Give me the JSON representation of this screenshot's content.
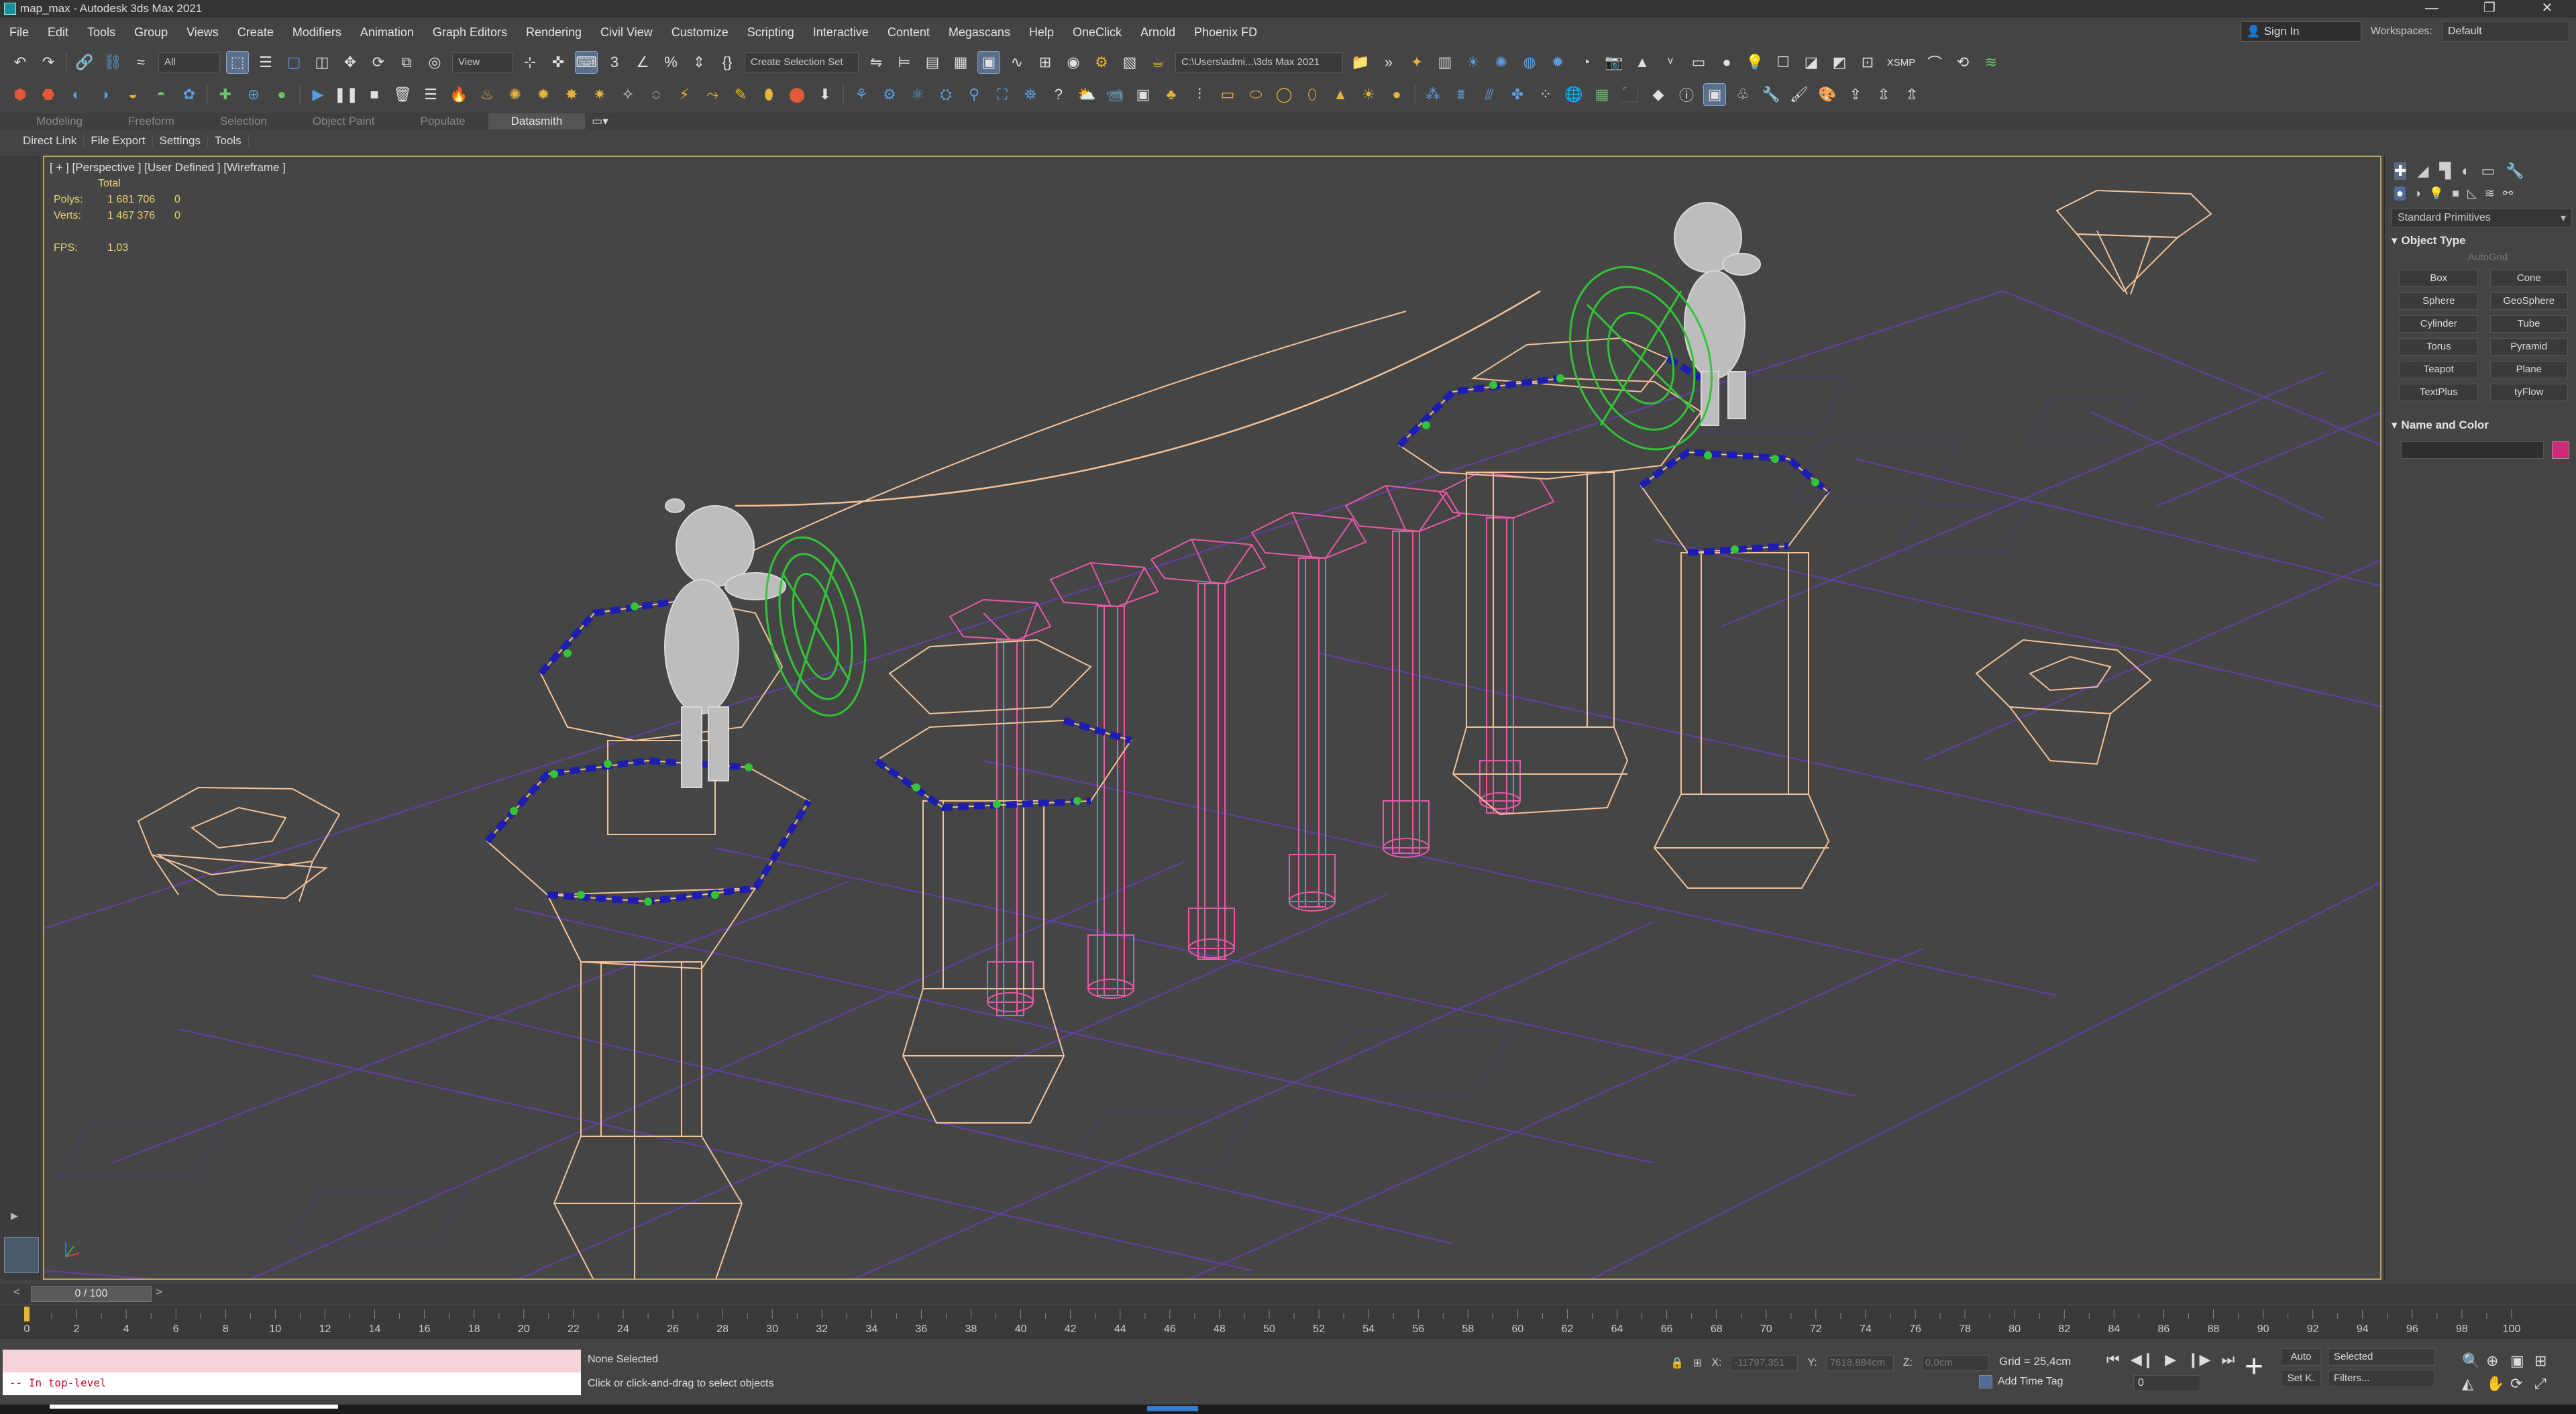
{
  "window": {
    "title": "map_max - Autodesk 3ds Max 2021",
    "controls": [
      "—",
      "❐",
      "✕"
    ]
  },
  "menubar": {
    "items": [
      "File",
      "Edit",
      "Tools",
      "Group",
      "Views",
      "Create",
      "Modifiers",
      "Animation",
      "Graph Editors",
      "Rendering",
      "Civil View",
      "Customize",
      "Scripting",
      "Interactive",
      "Content",
      "Megascans",
      "Help",
      "OneClick",
      "Arnold",
      "Phoenix FD"
    ],
    "signin": "Sign In",
    "workspaces_label": "Workspaces:",
    "workspace_value": "Default"
  },
  "toolbar1": {
    "filter": "All",
    "ref_coord": "View",
    "selection_set": "Create Selection Set",
    "path": "C:\\Users\\admi...\\3ds Max 2021",
    "xsmp": "XSMP"
  },
  "ribbon": {
    "tabs": [
      "Modeling",
      "Freeform",
      "Selection",
      "Object Paint",
      "Populate",
      "Datasmith"
    ],
    "active_tab": "Datasmith"
  },
  "subtabs": [
    "Direct Link",
    "File Export",
    "Settings",
    "Tools"
  ],
  "viewport": {
    "label": "[ + ] [Perspective ] [User Defined ] [Wireframe ]",
    "stats": {
      "header": "Total",
      "polys_label": "Polys:",
      "polys_value": "1 681 706",
      "polys_sel": "0",
      "verts_label": "Verts:",
      "verts_value": "1 467 376",
      "verts_sel": "0",
      "fps_label": "FPS:",
      "fps_value": "1,03"
    }
  },
  "command_panel": {
    "category": "Standard Primitives",
    "object_type_title": "Object Type",
    "autogrid": "AutoGrid",
    "primitives": [
      "Box",
      "Cone",
      "Sphere",
      "GeoSphere",
      "Cylinder",
      "Tube",
      "Torus",
      "Pyramid",
      "Teapot",
      "Plane",
      "TextPlus",
      "tyFlow"
    ],
    "name_color_title": "Name and Color",
    "swatch_color": "#d2287a"
  },
  "timeline": {
    "frame_display": "0 / 100",
    "ticks": [
      "0",
      "2",
      "4",
      "6",
      "8",
      "10",
      "12",
      "14",
      "16",
      "18",
      "20",
      "22",
      "24",
      "26",
      "28",
      "30",
      "32",
      "34",
      "36",
      "38",
      "40",
      "42",
      "44",
      "46",
      "48",
      "50",
      "52",
      "54",
      "56",
      "58",
      "60",
      "62",
      "64",
      "66",
      "68",
      "70",
      "72",
      "74",
      "76",
      "78",
      "80",
      "82",
      "84",
      "86",
      "88",
      "90",
      "92",
      "94",
      "96",
      "98",
      "100"
    ]
  },
  "status": {
    "maxscript_output": "-- In top-level",
    "selection": "None Selected",
    "prompt": "Click or click-and-drag to select objects",
    "x_label": "X:",
    "x_value": "-11797,351",
    "y_label": "Y:",
    "y_value": "7618,884cm",
    "z_label": "Z:",
    "z_value": "0,0cm",
    "grid": "Grid = 25,4cm",
    "add_time_tag": "Add Time Tag",
    "current_frame": "0",
    "auto_key": "Auto",
    "set_key": "Set K.",
    "key_filter": "Selected",
    "filters": "Filters..."
  },
  "colors": {
    "viewport_border": "#b8a75a",
    "wire_peach": "#f3c39b",
    "wire_pink": "#e75aa8",
    "wire_green": "#34c438",
    "grid_purple": "#6b3dc8",
    "marker_blue": "#1d1db0"
  }
}
